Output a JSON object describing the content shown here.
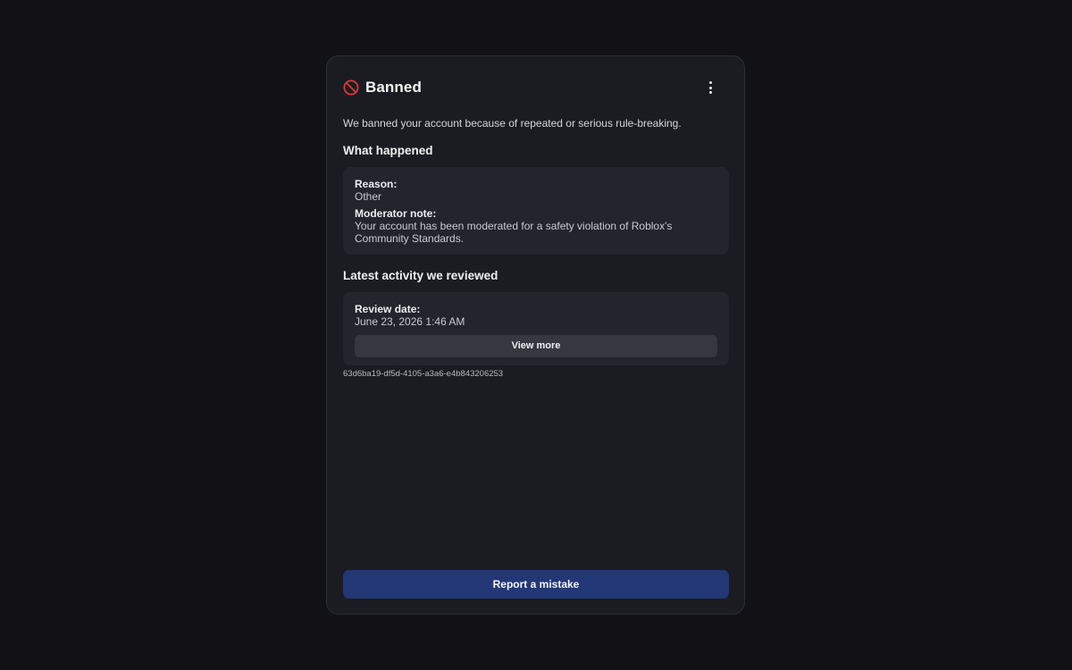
{
  "header": {
    "title": "Banned",
    "icon": "ban-icon",
    "menu_icon": "more-vertical-icon"
  },
  "intro": "We banned your account because of repeated or serious rule-breaking.",
  "what_happened": {
    "title": "What happened",
    "reason_label": "Reason:",
    "reason_value": "Other",
    "note_label": "Moderator note:",
    "note_value": "Your account has been moderated for a safety violation of Roblox's Community Standards."
  },
  "latest_activity": {
    "title": "Latest activity we reviewed",
    "review_date_label": "Review date:",
    "review_date_value": "June 23, 2026 1:46 AM",
    "view_more_label": "View more"
  },
  "reference_id": "63d6ba19-df5d-4105-a3a6-e4b843206253",
  "footer": {
    "report_label": "Report a mistake"
  },
  "colors": {
    "background": "#111116",
    "panel": "#1b1c21",
    "card": "#23242c",
    "ban_red": "#d63a3a",
    "primary_button": "#233777"
  }
}
